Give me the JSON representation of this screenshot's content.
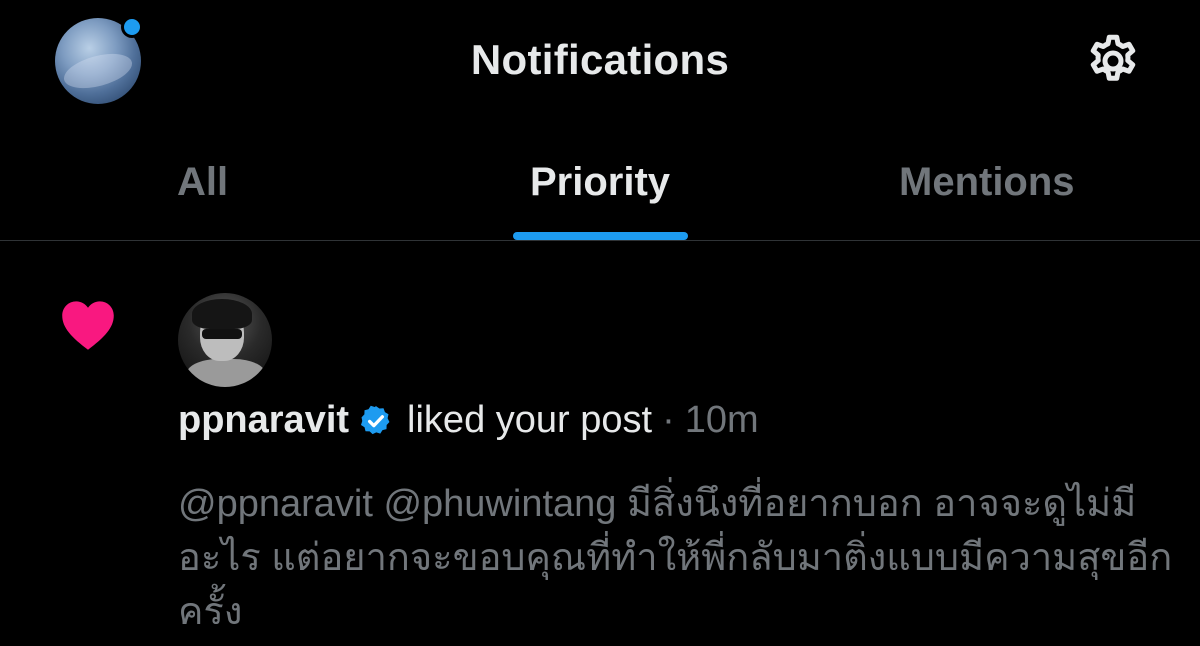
{
  "header": {
    "title": "Notifications",
    "avatar_icon": "profile-avatar-icon",
    "settings_icon": "gear-icon"
  },
  "tabs": [
    {
      "label": "All",
      "active": false
    },
    {
      "label": "Priority",
      "active": true
    },
    {
      "label": "Mentions",
      "active": false
    }
  ],
  "notification": {
    "icon": "heart-icon",
    "username": "ppnaravit",
    "verified": true,
    "action": "liked your post",
    "separator": "·",
    "time": "10m",
    "post_text": "@ppnaravit @phuwintang มีสิ่งนึงที่อยากบอก อาจจะดูไม่มีอะไร แต่อยากจะขอบคุณที่ทำให้พี่กลับมาติ่งแบบมีความสุขอีกครั้ง"
  },
  "colors": {
    "background": "#000000",
    "primary_text": "#e7e9ea",
    "secondary_text": "#71767b",
    "accent": "#1d9bf0",
    "heart": "#f91880",
    "divider": "#2f3336"
  }
}
